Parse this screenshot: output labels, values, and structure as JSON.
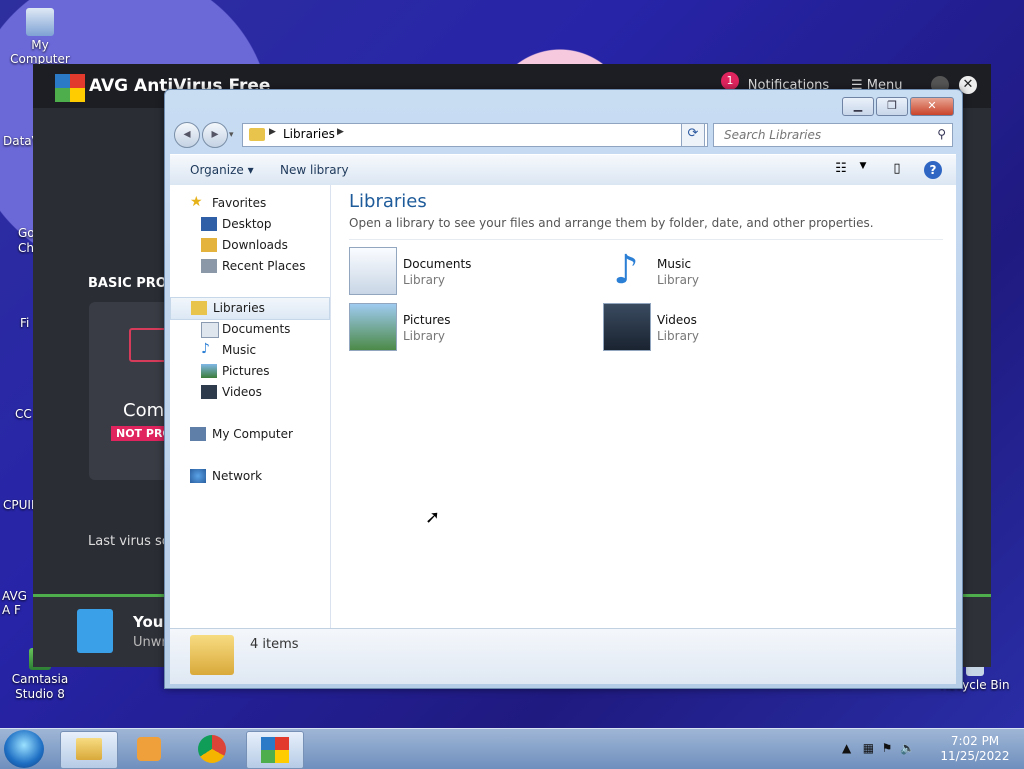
{
  "desktop": {
    "icons": [
      {
        "label": "My Computer"
      },
      {
        "label": "Camtasia Studio 8"
      },
      {
        "label": "Recycle Bin"
      }
    ],
    "partial_labels": [
      "DataV",
      "Go Ch",
      "Fi",
      "CC",
      "CPUII",
      "AVG A F"
    ]
  },
  "avg": {
    "title": "AVG AntiVirus Free",
    "notifications_count": "1",
    "notifications_label": "Notifications",
    "menu_label": "Menu",
    "close_glyph": "✕",
    "basic_protection": "BASIC PROT",
    "card_title": "Comp",
    "card_status": "NOT PRO",
    "last_scan": "Last virus sc",
    "bottom_title": "Your",
    "bottom_sub": "Unwr"
  },
  "explorer": {
    "address": {
      "path": "Libraries"
    },
    "search_placeholder": "Search Libraries",
    "toolbar": {
      "organize": "Organize ▾",
      "new_library": "New library"
    },
    "nav": {
      "favorites": "Favorites",
      "desktop": "Desktop",
      "downloads": "Downloads",
      "recent": "Recent Places",
      "libraries": "Libraries",
      "documents": "Documents",
      "music": "Music",
      "pictures": "Pictures",
      "videos": "Videos",
      "my_computer": "My Computer",
      "network": "Network"
    },
    "content": {
      "title": "Libraries",
      "description": "Open a library to see your files and arrange them by folder, date, and other properties.",
      "libraries": [
        {
          "name": "Documents",
          "type": "Library"
        },
        {
          "name": "Music",
          "type": "Library"
        },
        {
          "name": "Pictures",
          "type": "Library"
        },
        {
          "name": "Videos",
          "type": "Library"
        }
      ]
    },
    "details": {
      "count": "4 items"
    }
  },
  "taskbar": {
    "time": "7:02 PM",
    "date": "11/25/2022"
  }
}
